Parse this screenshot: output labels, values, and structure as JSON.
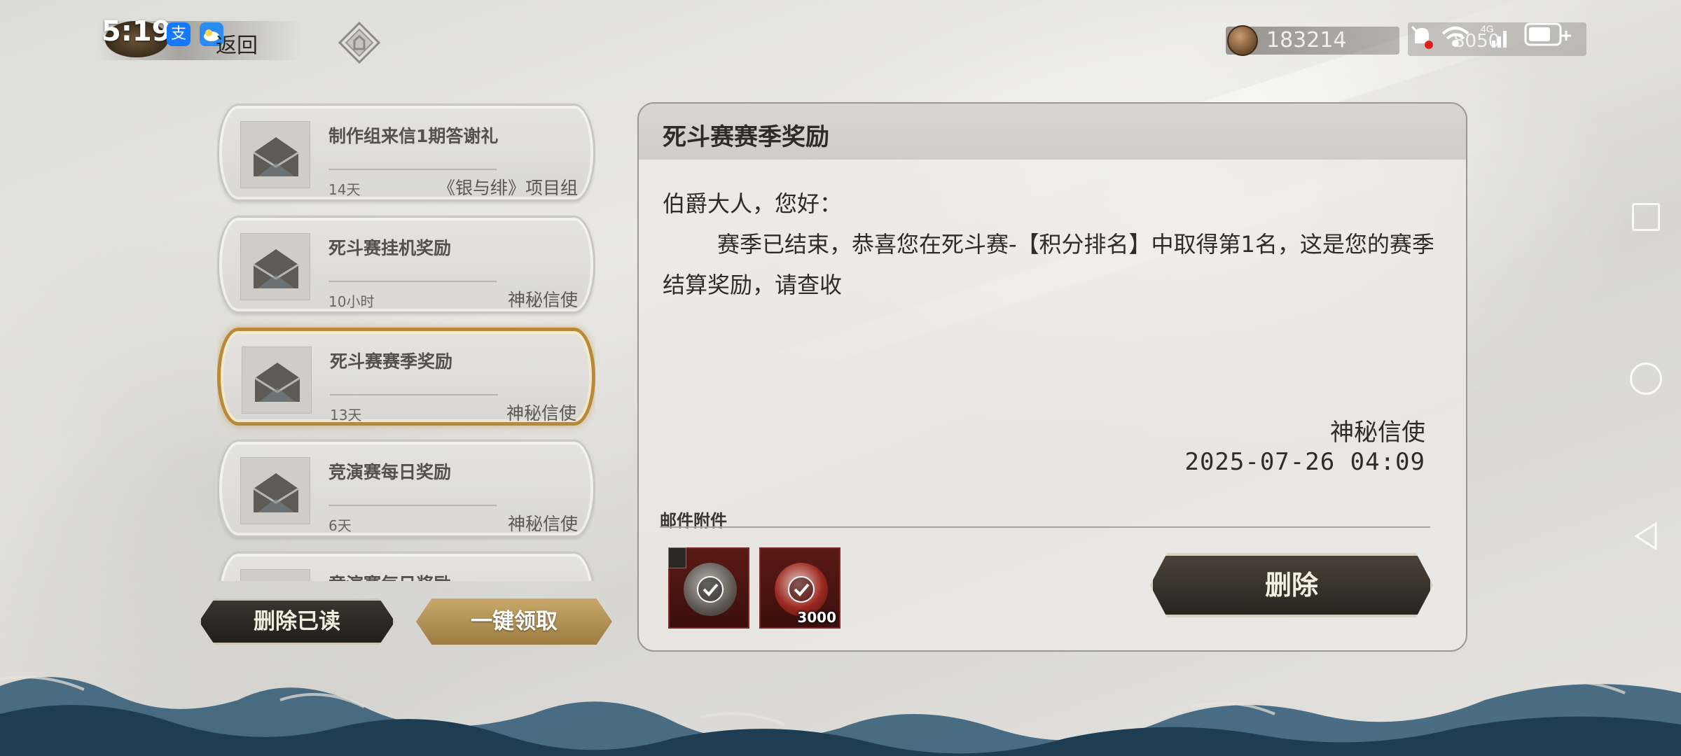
{
  "status_bar": {
    "time": "5:19",
    "app_icons": [
      "支",
      "cloud-app"
    ],
    "signal_label": "4G",
    "right_value": "8050"
  },
  "top_bar": {
    "back_label": "返回",
    "currency_value": "183214"
  },
  "mail_list": {
    "items": [
      {
        "title": "制作组来信1期答谢礼",
        "age": "14天",
        "sender": "《银与绯》项目组",
        "selected": false
      },
      {
        "title": "死斗赛挂机奖励",
        "age": "10小时",
        "sender": "神秘信使",
        "selected": false
      },
      {
        "title": "死斗赛赛季奖励",
        "age": "13天",
        "sender": "神秘信使",
        "selected": true
      },
      {
        "title": "竞演赛每日奖励",
        "age": "6天",
        "sender": "神秘信使",
        "selected": false
      },
      {
        "title": "竞演赛每日奖励",
        "age": "",
        "sender": "",
        "selected": false
      }
    ],
    "delete_read_label": "删除已读",
    "claim_all_label": "一键领取"
  },
  "detail": {
    "title": "死斗赛赛季奖励",
    "greeting": "伯爵大人，您好：",
    "body": "赛季已结束，恭喜您在死斗赛-【积分排名】中取得第1名，这是您的赛季结算奖励，请查收",
    "sender": "神秘信使",
    "date": "2025-07-26  04:09",
    "attachments_label": "邮件附件",
    "attachments": [
      {
        "name": "season-badge-item",
        "count": "",
        "claimed": true,
        "has_corner_badge": true
      },
      {
        "name": "crimson-orb-item",
        "count": "3000",
        "claimed": true,
        "has_corner_badge": false
      }
    ],
    "delete_label": "删除"
  },
  "colors": {
    "gold_accent": "#b88a38",
    "dark_button": "#2a2520",
    "attachment_red": "#5a1a16",
    "wave_blue": "#254a63"
  }
}
